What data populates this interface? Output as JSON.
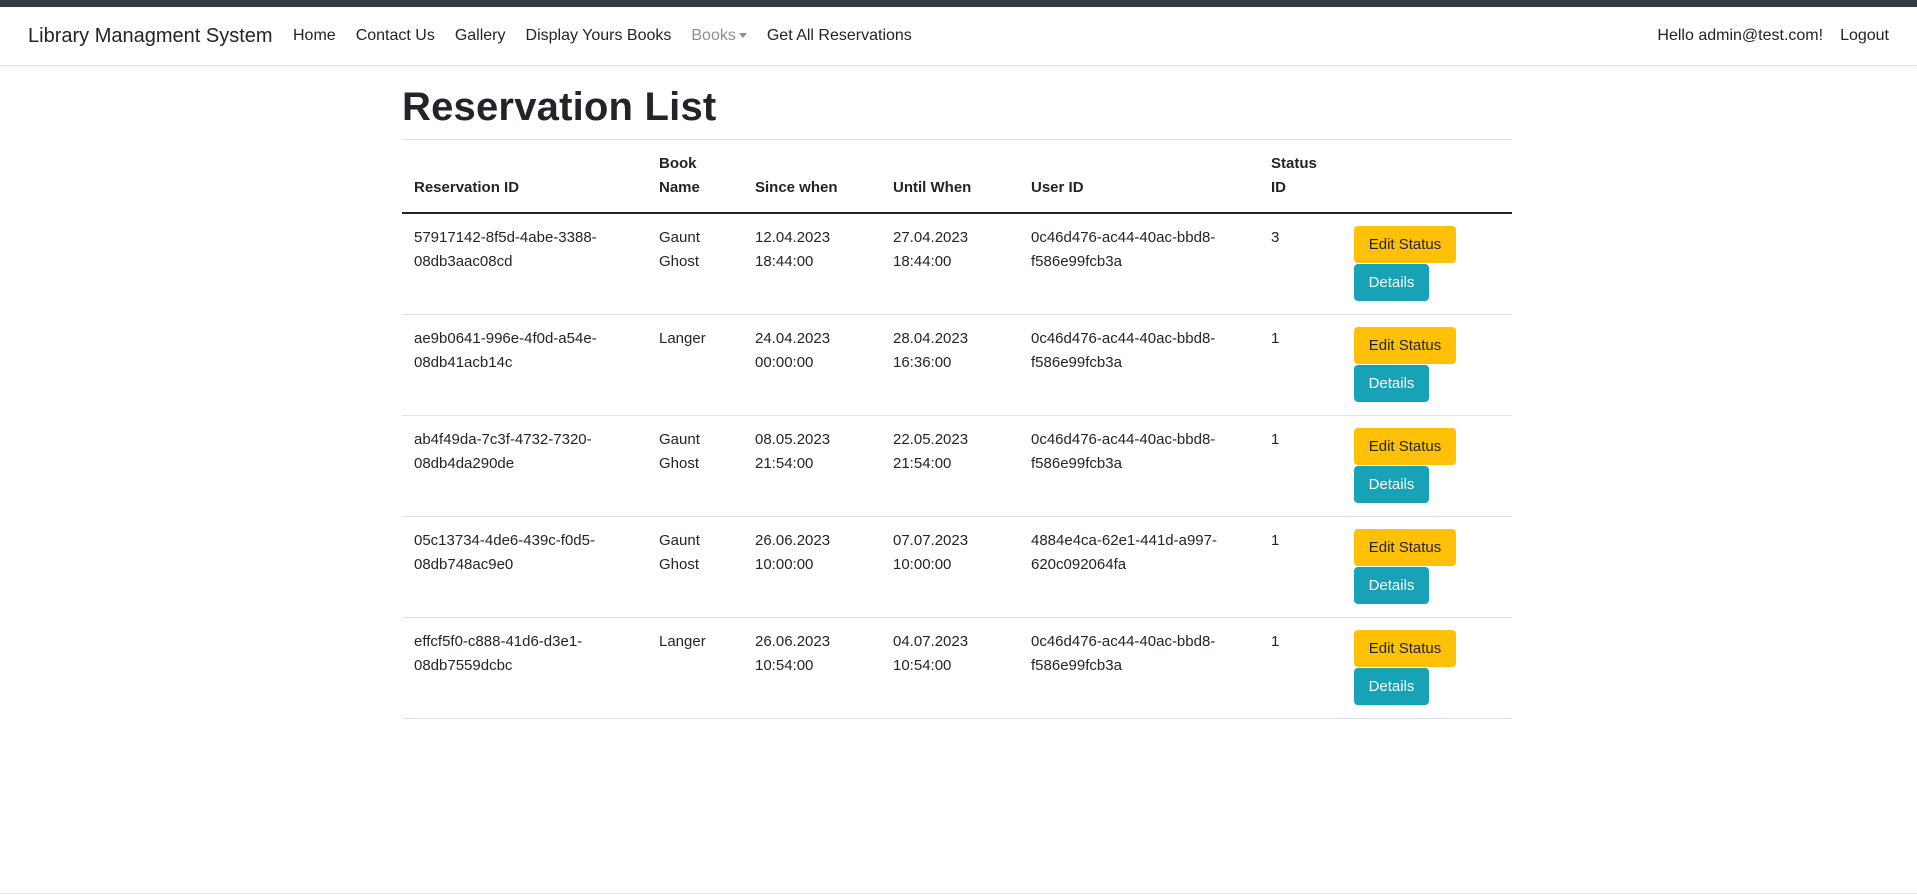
{
  "nav": {
    "brand": "Library Managment System",
    "links": [
      "Home",
      "Contact Us",
      "Gallery",
      "Display Yours Books",
      "Books",
      "Get All Reservations"
    ],
    "greeting": "Hello admin@test.com!",
    "logout": "Logout"
  },
  "page": {
    "title": "Reservation List"
  },
  "table": {
    "headers": [
      "Reservation ID",
      "Book Name",
      "Since when",
      "Until When",
      "User ID",
      "Status ID"
    ],
    "edit_label": "Edit Status",
    "details_label": "Details",
    "rows": [
      {
        "id": "57917142-8f5d-4abe-3388-08db3aac08cd",
        "book": "Gaunt Ghost",
        "since": "12.04.2023 18:44:00",
        "until": "27.04.2023 18:44:00",
        "user": "0c46d476-ac44-40ac-bbd8-f586e99fcb3a",
        "status": "3"
      },
      {
        "id": "ae9b0641-996e-4f0d-a54e-08db41acb14c",
        "book": "Langer",
        "since": "24.04.2023 00:00:00",
        "until": "28.04.2023 16:36:00",
        "user": "0c46d476-ac44-40ac-bbd8-f586e99fcb3a",
        "status": "1"
      },
      {
        "id": "ab4f49da-7c3f-4732-7320-08db4da290de",
        "book": "Gaunt Ghost",
        "since": "08.05.2023 21:54:00",
        "until": "22.05.2023 21:54:00",
        "user": "0c46d476-ac44-40ac-bbd8-f586e99fcb3a",
        "status": "1"
      },
      {
        "id": "05c13734-4de6-439c-f0d5-08db748ac9e0",
        "book": "Gaunt Ghost",
        "since": "26.06.2023 10:00:00",
        "until": "07.07.2023 10:00:00",
        "user": "4884e4ca-62e1-441d-a997-620c092064fa",
        "status": "1"
      },
      {
        "id": "effcf5f0-c888-41d6-d3e1-08db7559dcbc",
        "book": "Langer",
        "since": "26.06.2023 10:54:00",
        "until": "04.07.2023 10:54:00",
        "user": "0c46d476-ac44-40ac-bbd8-f586e99fcb3a",
        "status": "1"
      }
    ]
  }
}
